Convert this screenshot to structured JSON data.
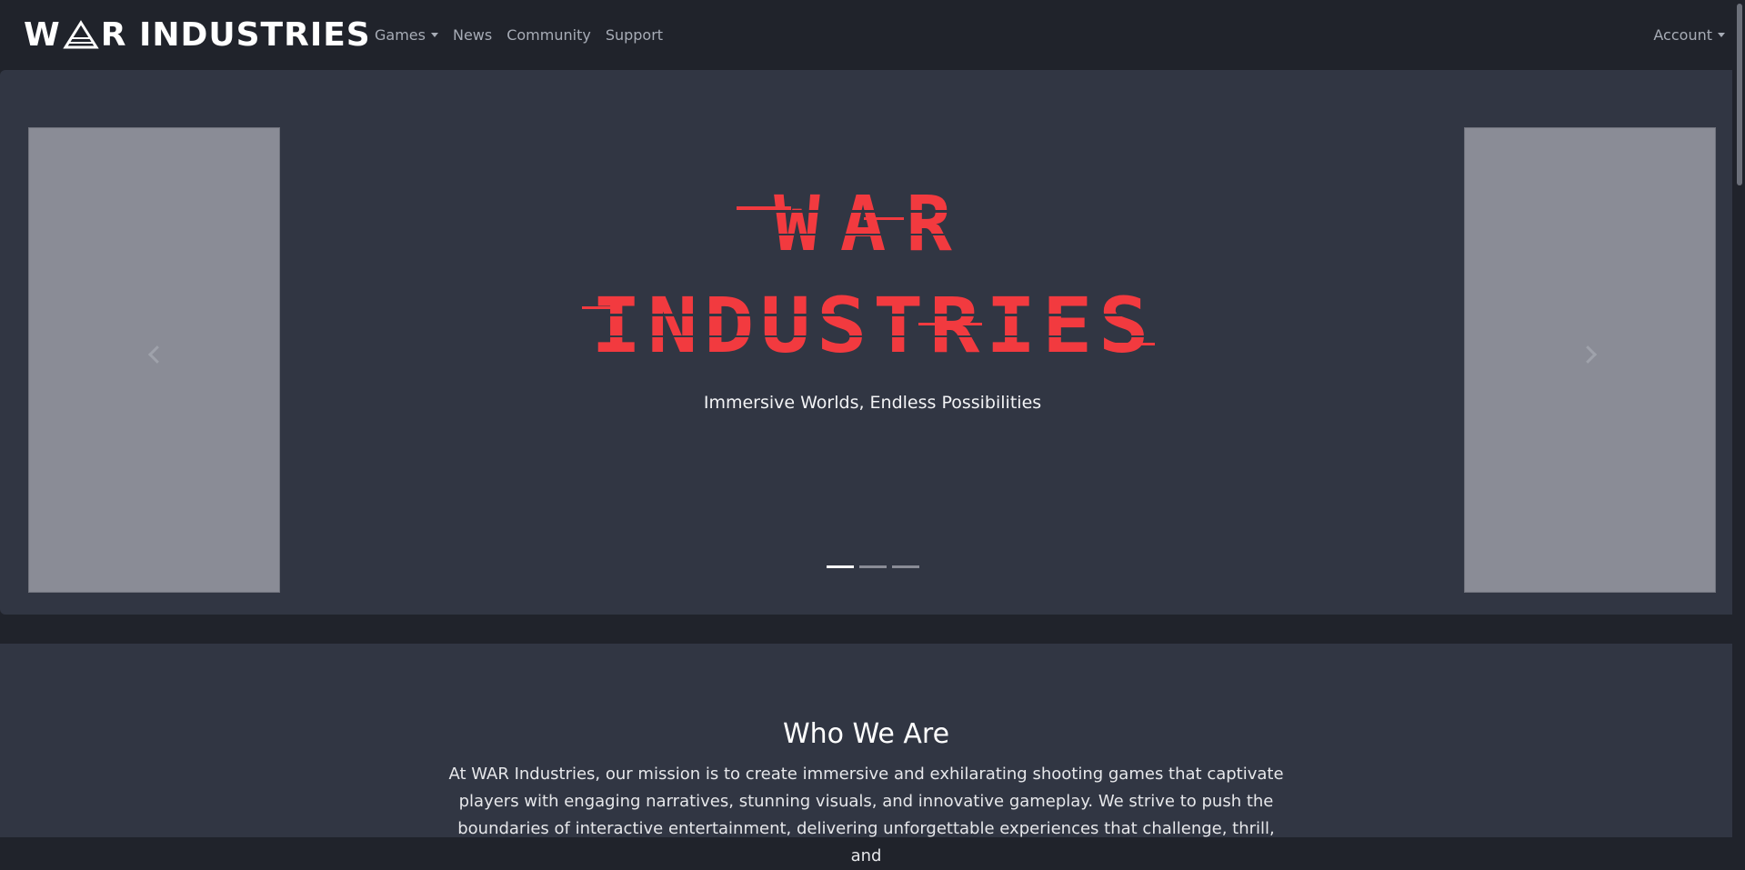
{
  "brand": {
    "name_left": "W",
    "name_mid": "R INDUSTRIES",
    "mark_icon": "triangle-a-logo-icon"
  },
  "nav": {
    "games": "Games",
    "news": "News",
    "community": "Community",
    "support": "Support",
    "account": "Account"
  },
  "hero": {
    "logo_line1": "WAR",
    "logo_line2": "INDUSTRIES",
    "logo_color": "#f23a3f",
    "subtitle": "Immersive Worlds, Endless Possibilities",
    "prev_icon": "chevron-left-icon",
    "next_icon": "chevron-right-icon",
    "slides_total": 3,
    "active_slide": 1
  },
  "about": {
    "title": "Who We Are",
    "text": "At WAR Industries, our mission is to create immersive and exhilarating shooting games that captivate players with engaging narratives, stunning visuals, and innovative gameplay. We strive to push the boundaries of interactive entertainment, delivering unforgettable experiences that challenge, thrill, and"
  },
  "colors": {
    "page_bg": "#20232b",
    "panel_bg": "#313643",
    "side_panel": "#8a8c96",
    "accent_red": "#f23a3f"
  }
}
